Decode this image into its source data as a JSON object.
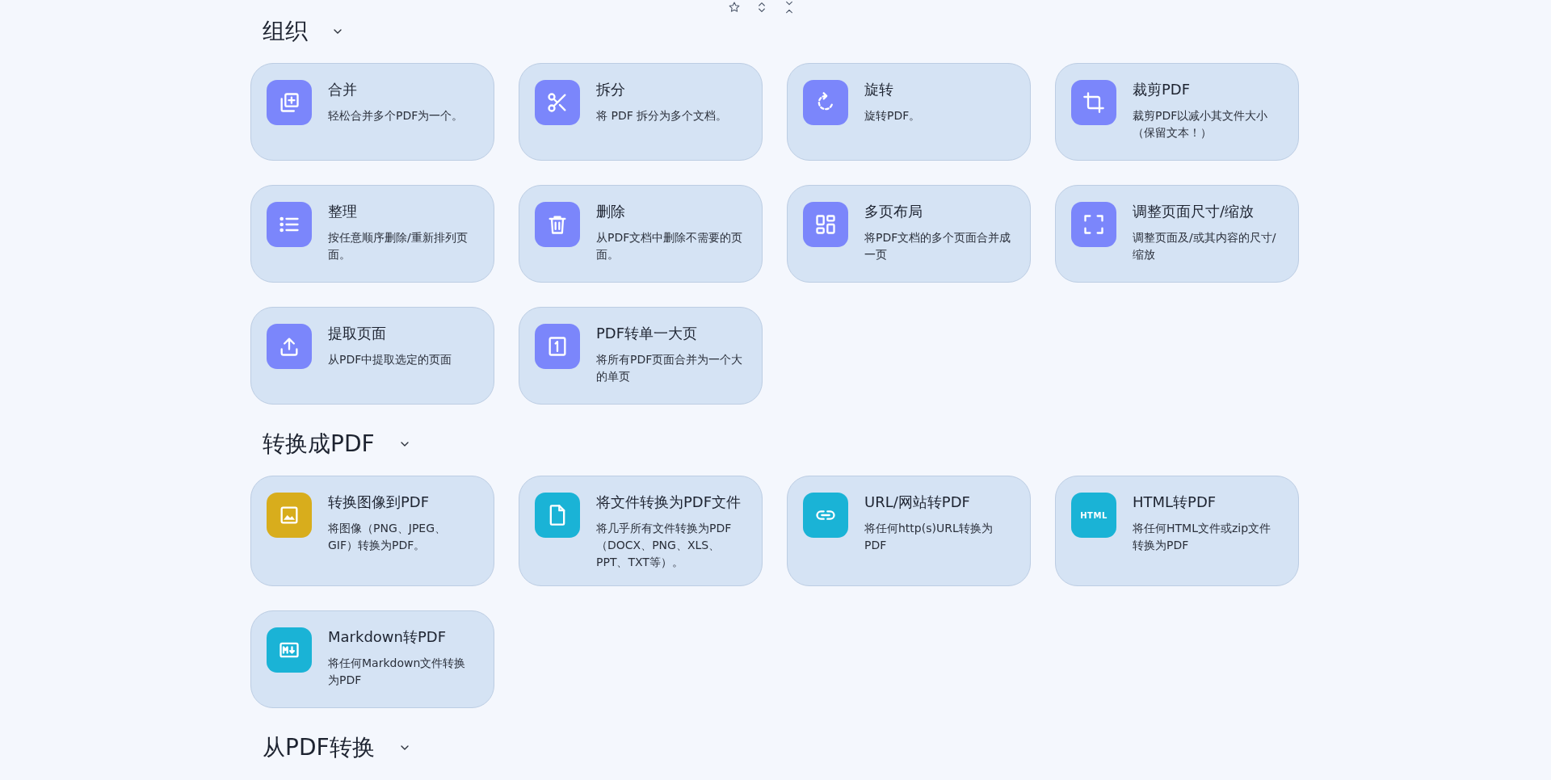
{
  "sections": [
    {
      "title": "组织",
      "tools": [
        {
          "title": "合并",
          "description": "轻松合并多个PDF为一个。",
          "color": "#7b86fb"
        },
        {
          "title": "拆分",
          "description": "将 PDF 拆分为多个文档。",
          "color": "#7b86fb"
        },
        {
          "title": "旋转",
          "description": "旋转PDF。",
          "color": "#7b86fb"
        },
        {
          "title": "裁剪PDF",
          "description": "裁剪PDF以减小其文件大小（保留文本！）",
          "color": "#7b86fb"
        },
        {
          "title": "整理",
          "description": "按任意顺序删除/重新排列页面。",
          "color": "#7b86fb"
        },
        {
          "title": "删除",
          "description": "从PDF文档中删除不需要的页面。",
          "color": "#7b86fb"
        },
        {
          "title": "多页布局",
          "description": "将PDF文档的多个页面合并成一页",
          "color": "#7b86fb"
        },
        {
          "title": "调整页面尺寸/缩放",
          "description": "调整页面及/或其内容的尺寸/缩放",
          "color": "#7b86fb"
        },
        {
          "title": "提取页面",
          "description": "从PDF中提取选定的页面",
          "color": "#7b86fb"
        },
        {
          "title": "PDF转单一大页",
          "description": "将所有PDF页面合并为一个大的单页",
          "color": "#7b86fb"
        }
      ]
    },
    {
      "title": "转换成PDF",
      "tools": [
        {
          "title": "转换图像到PDF",
          "description": "将图像（PNG、JPEG、GIF）转换为PDF。",
          "color": "#d8ad1c"
        },
        {
          "title": "将文件转换为PDF文件",
          "description": "将几乎所有文件转换为PDF（DOCX、PNG、XLS、PPT、TXT等）。",
          "color": "#1ab3d6"
        },
        {
          "title": "URL/网站转PDF",
          "description": "将任何http(s)URL转换为PDF",
          "color": "#1ab3d6"
        },
        {
          "title": "HTML转PDF",
          "description": "将任何HTML文件或zip文件转换为PDF",
          "color": "#1ab3d6",
          "icon_text": "HTML"
        },
        {
          "title": "Markdown转PDF",
          "description": "将任何Markdown文件转换为PDF",
          "color": "#1ab3d6"
        }
      ]
    },
    {
      "title": "从PDF转换"
    }
  ]
}
